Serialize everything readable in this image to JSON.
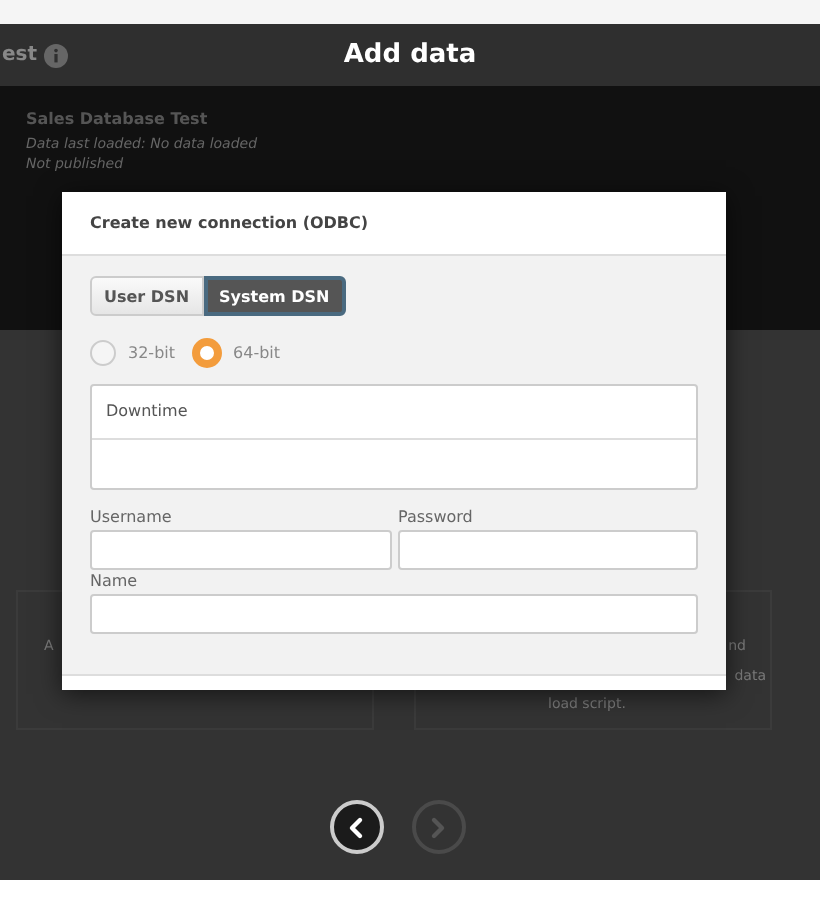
{
  "header": {
    "app_title": "est",
    "title": "Add data"
  },
  "app_info": {
    "name": "Sales Database Test",
    "last_loaded": "Data last loaded: No data loaded",
    "status": "Not published"
  },
  "cards": [
    {
      "fragments": [
        "A"
      ]
    },
    {
      "fragments": [
        "nd",
        "data",
        "load script."
      ]
    }
  ],
  "dialog": {
    "title": "Create new connection (ODBC)",
    "dsn_tabs": [
      {
        "label": "User DSN",
        "selected": false
      },
      {
        "label": "System DSN",
        "selected": true
      }
    ],
    "bitness": [
      {
        "label": "32-bit",
        "selected": false
      },
      {
        "label": "64-bit",
        "selected": true
      }
    ],
    "dsn_list": [
      {
        "label": "Downtime"
      }
    ],
    "fields": [
      {
        "label": "Username"
      },
      {
        "label": "Password"
      },
      {
        "label": "Name"
      }
    ]
  },
  "nav": [
    {
      "kind": "back",
      "disabled": false
    },
    {
      "kind": "next",
      "disabled": true
    }
  ]
}
